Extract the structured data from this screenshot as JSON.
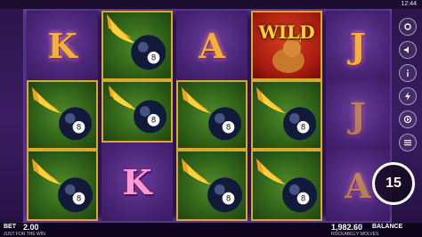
{
  "status": {
    "clock": "12:44"
  },
  "reels": {
    "cells": [
      {
        "id": "r1c1",
        "symbol": "K",
        "kind": "letter",
        "color": "gold"
      },
      {
        "id": "r2c1",
        "symbol": "8-ball",
        "kind": "ball"
      },
      {
        "id": "r3c1",
        "symbol": "A",
        "kind": "letter",
        "color": "gold"
      },
      {
        "id": "r4c1",
        "symbol": "WILD",
        "kind": "wild"
      },
      {
        "id": "r5c1",
        "symbol": "J",
        "kind": "letter",
        "color": "gold"
      },
      {
        "id": "r1c2",
        "symbol": "8-ball",
        "kind": "ball"
      },
      {
        "id": "r2c2",
        "symbol": "8-ball",
        "kind": "ball"
      },
      {
        "id": "r3c2",
        "symbol": "8-ball",
        "kind": "ball"
      },
      {
        "id": "r4c2",
        "symbol": "8-ball",
        "kind": "ball"
      },
      {
        "id": "r5c2",
        "symbol": "J",
        "kind": "letter",
        "color": "gold"
      },
      {
        "id": "r1c3",
        "symbol": "8-ball",
        "kind": "ball"
      },
      {
        "id": "r2c3",
        "symbol": "K",
        "kind": "letter",
        "color": "pink"
      },
      {
        "id": "r3c3",
        "symbol": "8-ball",
        "kind": "ball"
      },
      {
        "id": "r4c3",
        "symbol": "8-ball",
        "kind": "ball"
      },
      {
        "id": "r5c3",
        "symbol": "A",
        "kind": "letter",
        "color": "gold"
      }
    ]
  },
  "wild_label": "WILD",
  "ball_number": "8",
  "spin": {
    "autoplay_count": "15"
  },
  "bottom": {
    "bet_label": "BET",
    "bet_value": "2.00",
    "bet_sub": "JUST FOR THE WIN",
    "balance_value": "1,982.60",
    "balance_label": "BALANCE",
    "game_name": "ROCKABILLY WOLVES"
  },
  "icons": [
    "gear-icon",
    "speaker-icon",
    "info-icon",
    "lightning-icon",
    "autoplay-icon",
    "menu-icon"
  ],
  "colors": {
    "frame_glow": "#aa6eff",
    "win_border": "#d9a82c",
    "letter_gold": "#f2b23a",
    "letter_pink": "#ff9ad0"
  }
}
